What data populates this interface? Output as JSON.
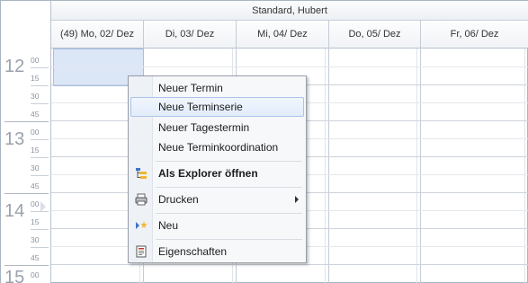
{
  "calendar": {
    "owner": "Standard, Hubert",
    "days": [
      "(49) Mo, 02/ Dez",
      "Di, 03/ Dez",
      "Mi, 04/ Dez",
      "Do, 05/ Dez",
      "Fr, 06/ Dez"
    ],
    "hours": [
      "12",
      "13",
      "14",
      "15"
    ],
    "minutes": [
      "00",
      "15",
      "30",
      "45"
    ]
  },
  "context_menu": {
    "items": [
      {
        "label": "Neuer Termin"
      },
      {
        "label": "Neue Terminserie",
        "highlighted": true
      },
      {
        "label": "Neuer Tagestermin"
      },
      {
        "label": "Neue Terminkoordination"
      },
      {
        "label": "Als Explorer öffnen",
        "icon": "explorer-icon",
        "bold": true
      },
      {
        "label": "Drucken",
        "icon": "printer-icon",
        "submenu": true
      },
      {
        "label": "Neu",
        "icon": "new-icon"
      },
      {
        "label": "Eigenschaften",
        "icon": "properties-icon"
      }
    ]
  },
  "colors": {
    "selection": "#dbe6f7",
    "menu_highlight": "#e2ecfa",
    "grid_line": "#cdd3db"
  }
}
